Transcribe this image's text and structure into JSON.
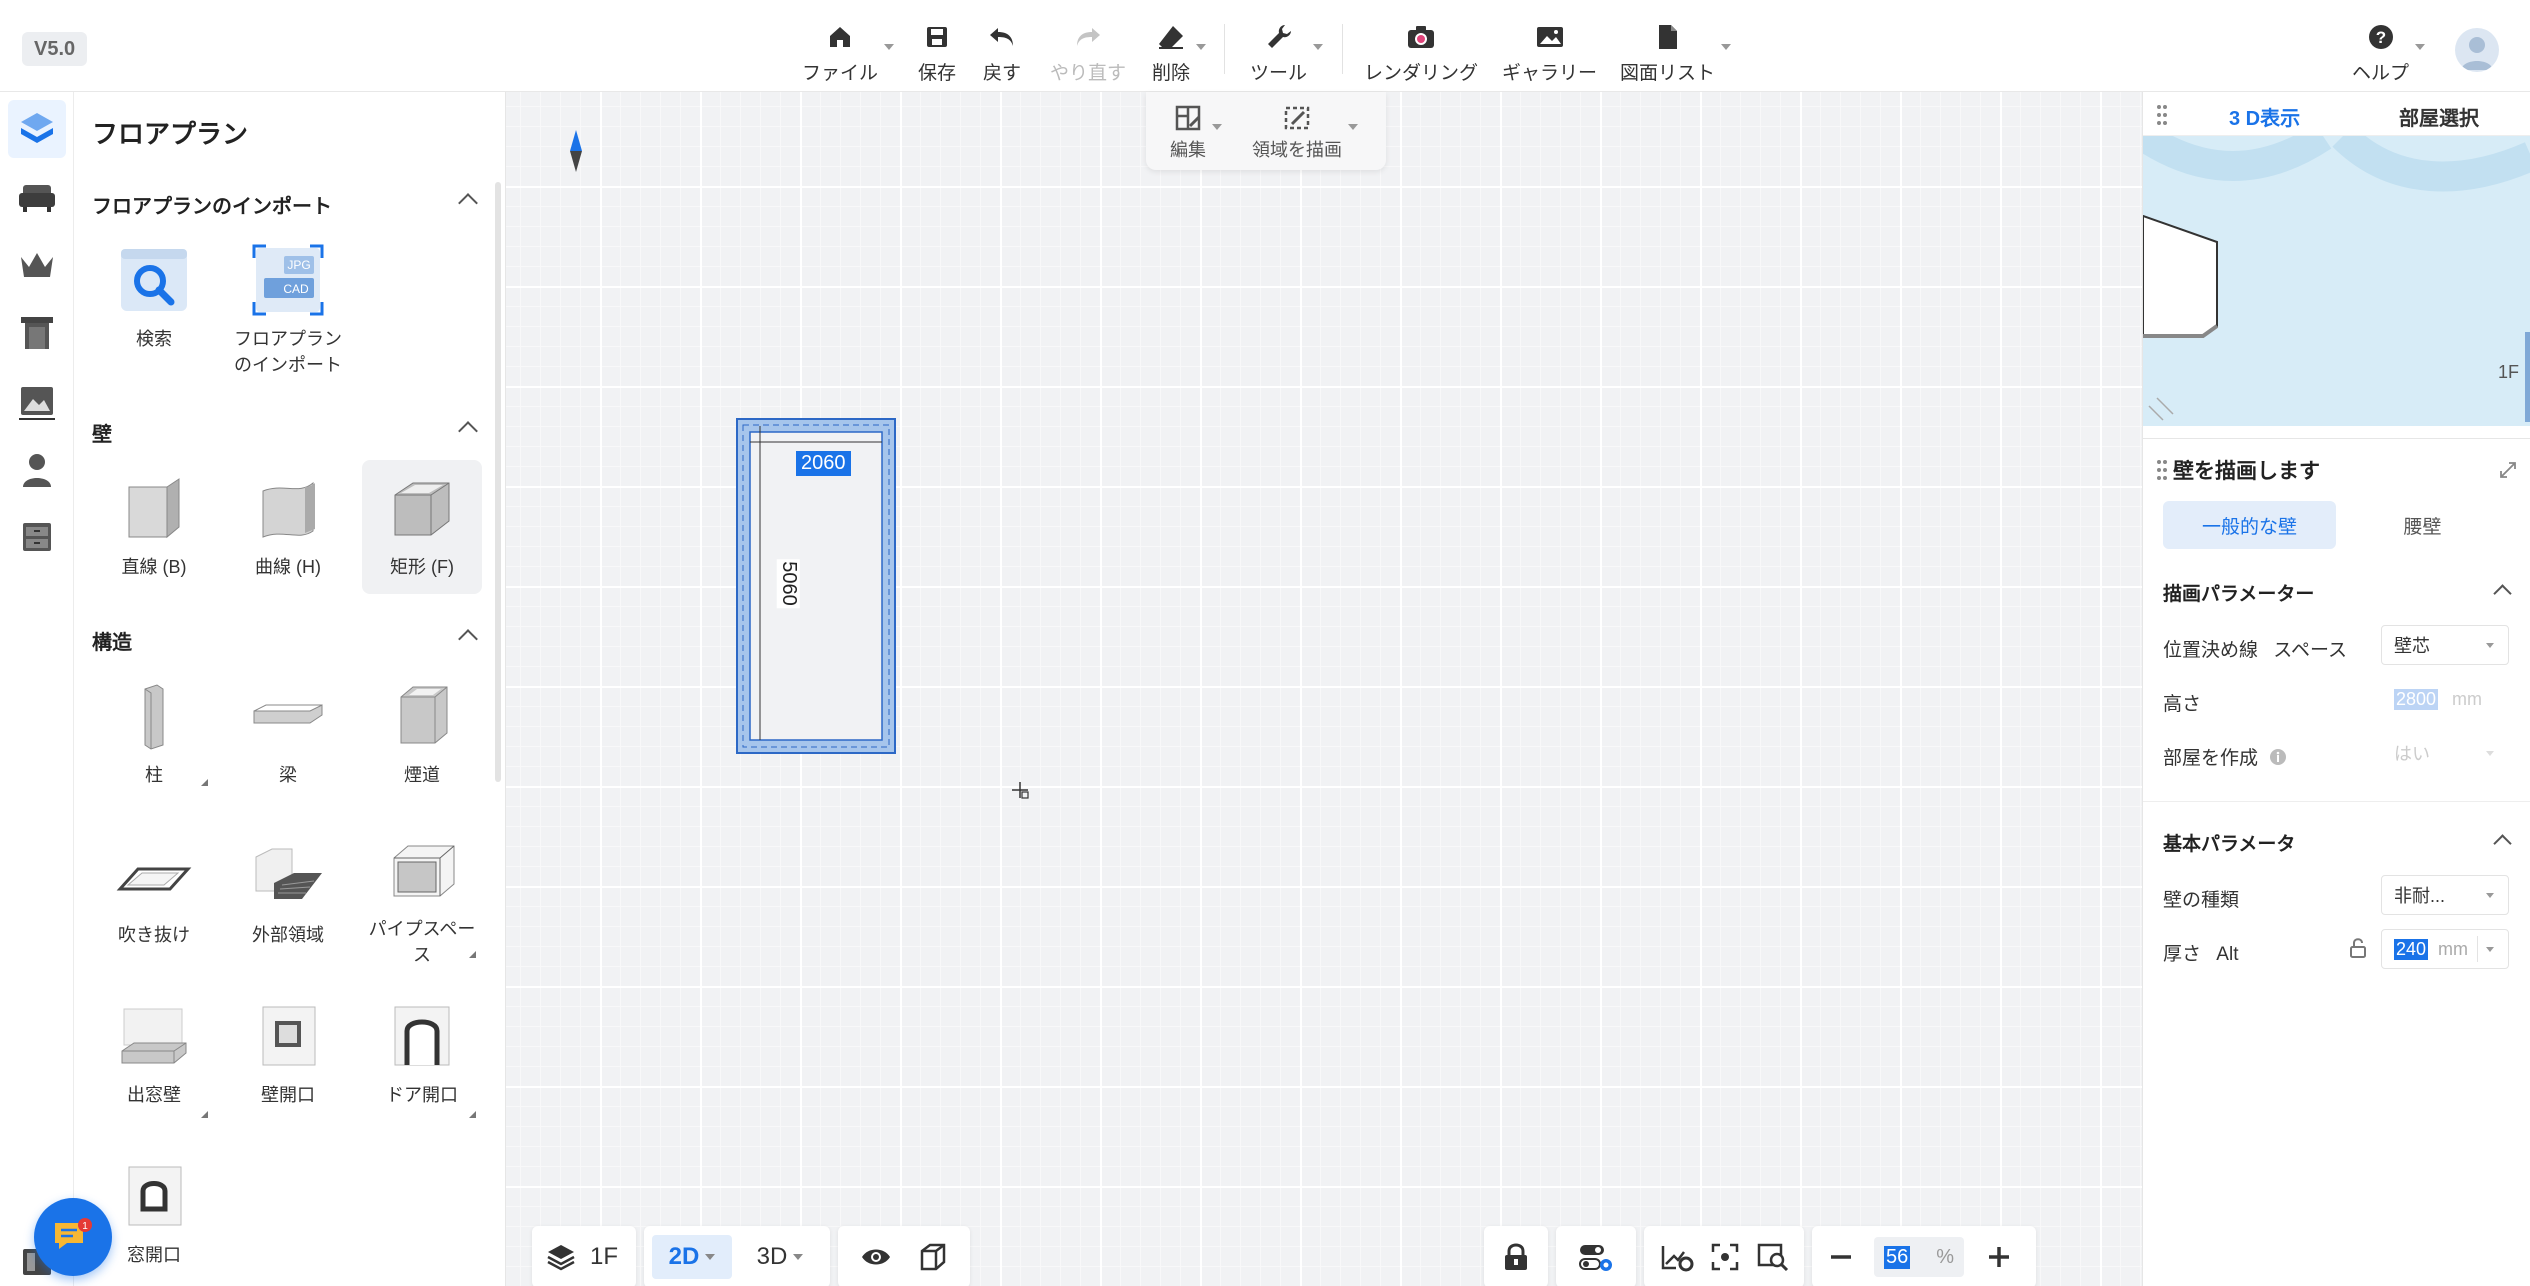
{
  "app": {
    "version": "V5.0"
  },
  "toolbar": {
    "file": "ファイル",
    "save": "保存",
    "undo": "戻す",
    "redo": "やり直す",
    "delete": "削除",
    "tools": "ツール",
    "rendering": "レンダリング",
    "gallery": "ギャラリー",
    "drawing_list": "図面リスト",
    "help": "ヘルプ"
  },
  "rail": [
    "floorplan-icon",
    "sofa-icon",
    "crown-icon",
    "door-icon",
    "landscape-icon",
    "person-icon",
    "cabinet-icon"
  ],
  "left_panel": {
    "title": "フロアプラン",
    "import_section": {
      "title": "フロアプランのインポート",
      "items": [
        {
          "label": "検索"
        },
        {
          "label_line1": "フロアプラン",
          "label_line2": "のインポート",
          "badge_top": "JPG",
          "badge_bottom": "CAD"
        }
      ]
    },
    "wall_section": {
      "title": "壁",
      "items": [
        {
          "label": "直線 (B)"
        },
        {
          "label": "曲線 (H)"
        },
        {
          "label": "矩形 (F)"
        }
      ]
    },
    "structure_section": {
      "title": "構造",
      "items": [
        {
          "label": "柱"
        },
        {
          "label": "梁"
        },
        {
          "label": "煙道"
        },
        {
          "label": "吹き抜け"
        },
        {
          "label": "外部領域"
        },
        {
          "label_line1": "パイプスペー",
          "label_line2": "ス"
        },
        {
          "label": "出窓壁"
        },
        {
          "label": "壁開口"
        },
        {
          "label": "ドア開口"
        },
        {
          "label": "窓開口"
        }
      ]
    }
  },
  "canvas": {
    "float_tools": {
      "edit": "編集",
      "draw_area": "領域を描画"
    },
    "room": {
      "width_label": "2060",
      "length_label": "5060"
    }
  },
  "bottom": {
    "floor": "1F",
    "view_2d": "2D",
    "view_3d": "3D",
    "zoom_value": "56",
    "zoom_unit": "%"
  },
  "right_panel": {
    "tab_3d": "3 D表示",
    "tab_room": "部屋選択",
    "preview_floor": "1F",
    "card_title": "壁を描画します",
    "seg_general": "一般的な壁",
    "seg_waist": "腰壁",
    "draw_params": {
      "title": "描画パラメーター",
      "position_label": "位置決め線",
      "position_sub": "スペース",
      "position_value": "壁芯",
      "height_label": "高さ",
      "height_value": "2800",
      "height_unit": "mm",
      "room_label": "部屋を作成",
      "room_value": "はい"
    },
    "basic_params": {
      "title": "基本パラメータ",
      "type_label": "壁の種類",
      "type_value": "非耐...",
      "thickness_label": "厚さ",
      "thickness_hint": "Alt",
      "thickness_value": "240",
      "thickness_unit": "mm"
    }
  },
  "chat": {
    "badge": "1"
  }
}
